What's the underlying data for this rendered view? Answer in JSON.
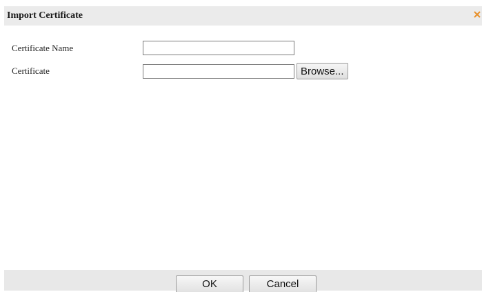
{
  "dialog": {
    "title": "Import Certificate",
    "close_icon": "close-icon",
    "accent_color": "#e8922e"
  },
  "form": {
    "certificate_name": {
      "label": "Certificate Name",
      "value": ""
    },
    "certificate": {
      "label": "Certificate",
      "value": "",
      "browse_label": "Browse..."
    }
  },
  "footer": {
    "ok_label": "OK",
    "cancel_label": "Cancel"
  }
}
